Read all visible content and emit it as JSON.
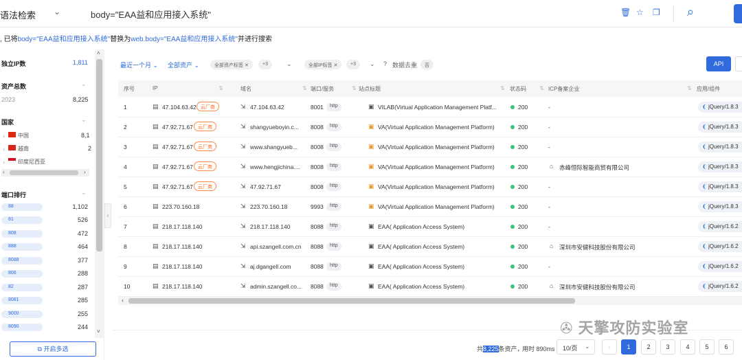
{
  "topbar": {
    "mode": "语法检索",
    "query": "body=\"EAA益和应用接入系统\""
  },
  "notice": {
    "prefix": ", 已将",
    "old": "body=\"EAA益和应用接入系统\"",
    "mid": "替换为",
    "new": "web.body=\"EAA益和应用接入系统\"",
    "suffix": "并进行搜索"
  },
  "sidebar": {
    "unique_ip": {
      "label": "独立IP数",
      "value": "1,811"
    },
    "assets": {
      "label": "资产总数",
      "year": "2023",
      "value": "8,225"
    },
    "countries": {
      "label": "国家",
      "items": [
        {
          "name": "中国",
          "count": "8,1"
        },
        {
          "name": "越南",
          "count": "2"
        },
        {
          "name": "印度尼西亚",
          "count": ""
        }
      ]
    },
    "ports": {
      "label": "端口排行",
      "items": [
        {
          "port": "88",
          "count": "1,102"
        },
        {
          "port": "81",
          "count": "526"
        },
        {
          "port": "808",
          "count": "472"
        },
        {
          "port": "888",
          "count": "464"
        },
        {
          "port": "8088",
          "count": "377"
        },
        {
          "port": "806",
          "count": "288"
        },
        {
          "port": "82",
          "count": "287"
        },
        {
          "port": "8081",
          "count": "285"
        },
        {
          "port": "9000",
          "count": "255"
        },
        {
          "port": "8090",
          "count": "244"
        }
      ]
    },
    "multi_select": "开启多选"
  },
  "filters": {
    "time": "最近一个月",
    "assets": "全部资产",
    "tag1": "全部资产标签",
    "plus1": "+3",
    "tag2": "全部IP标签",
    "plus2": "+3",
    "dedupe": "数据去重",
    "toggle": "否",
    "api": "API"
  },
  "table": {
    "headers": [
      "序号",
      "IP",
      "域名",
      "端口/服务",
      "站点标题",
      "状态码",
      "ICP备案企业",
      "应用/组件"
    ],
    "rows": [
      {
        "no": "1",
        "ip": "47.104.63.42",
        "cloud": "云厂商",
        "domain": "47.104.63.42",
        "port": "8001",
        "svc": "http",
        "title": "VILAB(Virtual Application Management Platf...",
        "status": "200",
        "icp": "-",
        "app": "jQuery/1.8.3"
      },
      {
        "no": "2",
        "ip": "47.92.71.67",
        "cloud": "云厂商",
        "domain": "shangyueboyin.c...",
        "port": "8008",
        "svc": "http",
        "title": "VA(Virtual Application Management Platform)",
        "status": "200",
        "icp": "-",
        "app": "jQuery/1.8.3"
      },
      {
        "no": "3",
        "ip": "47.92.71.67",
        "cloud": "云厂商",
        "domain": "www.shangyueb...",
        "port": "8008",
        "svc": "http",
        "title": "VA(Virtual Application Management Platform)",
        "status": "200",
        "icp": "-",
        "app": "jQuery/1.8.3"
      },
      {
        "no": "4",
        "ip": "47.92.71.67",
        "cloud": "云厂商",
        "domain": "www.hengjichina....",
        "port": "8008",
        "svc": "http",
        "title": "VA(Virtual Application Management Platform)",
        "status": "200",
        "icp": "赤峰恒际智能商贸有限公司",
        "app": "jQuery/1.8.3"
      },
      {
        "no": "5",
        "ip": "47.92.71.67",
        "cloud": "云厂商",
        "domain": "47.92.71.67",
        "port": "8008",
        "svc": "http",
        "title": "VA(Virtual Application Management Platform)",
        "status": "200",
        "icp": "-",
        "app": "jQuery/1.8.3"
      },
      {
        "no": "6",
        "ip": "223.70.160.18",
        "cloud": "",
        "domain": "223.70.160.18",
        "port": "9993",
        "svc": "http",
        "title": "VA(Virtual Application Management Platform)",
        "status": "200",
        "icp": "-",
        "app": "jQuery/1.8.3"
      },
      {
        "no": "7",
        "ip": "218.17.118.140",
        "cloud": "",
        "domain": "218.17.118.140",
        "port": "8088",
        "svc": "http",
        "title": "EAA( Application Access System)",
        "status": "200",
        "icp": "-",
        "app": "jQuery/1.6.2"
      },
      {
        "no": "8",
        "ip": "218.17.118.140",
        "cloud": "",
        "domain": "api.szangell.com.cn",
        "port": "8088",
        "svc": "http",
        "title": "EAA( Application Access System)",
        "status": "200",
        "icp": "深圳市安健科技股份有限公司",
        "app": "jQuery/1.6.2"
      },
      {
        "no": "9",
        "ip": "218.17.118.140",
        "cloud": "",
        "domain": "aj.dgangell.com",
        "port": "8088",
        "svc": "http",
        "title": "EAA( Application Access System)",
        "status": "200",
        "icp": "-",
        "app": "jQuery/1.6.2"
      },
      {
        "no": "10",
        "ip": "218.17.118.140",
        "cloud": "",
        "domain": "admin.szangell.co...",
        "port": "8088",
        "svc": "http",
        "title": "EAA( Application Access System)",
        "status": "200",
        "icp": "深圳市安健科技股份有限公司",
        "app": "jQuery/1.6.2"
      }
    ]
  },
  "footer": {
    "pre": "共",
    "total": "8,225",
    "post": "条资产，",
    "time": "用时 890ms",
    "page_size": "10/页",
    "pages": [
      "1",
      "2",
      "3",
      "4",
      "5",
      "6"
    ]
  },
  "watermark": "天擎攻防实验室",
  "colors": {
    "accent": "#2f6bdc",
    "cloud_tag": "#ff6a1a",
    "status_ok": "#3cc37a"
  }
}
